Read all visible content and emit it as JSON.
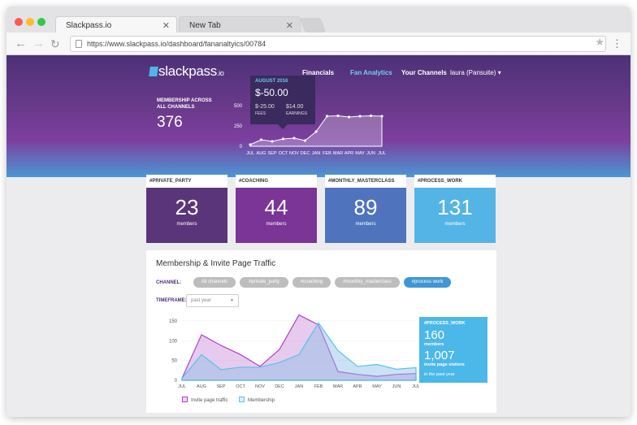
{
  "browser": {
    "tab_active": "Slackpass.io",
    "tab_inactive": "New Tab",
    "url": "https://www.slackpass.io/dashboard/fananaltyics/00784"
  },
  "app": {
    "logo": "slackpass",
    "logo_suffix": ".io",
    "nav": [
      "Financials",
      "Fan Analytics",
      "Your Channels"
    ],
    "user": "laura (Pansuite) ▾"
  },
  "hero": {
    "stat_label": "MEMBERSHIP ACROSS ALL CHANNELS",
    "stat_value": "376",
    "tooltip": {
      "month": "AUGUST 2016",
      "value": "$-50.00",
      "fees": "$-25.00",
      "fees_label": "FEES",
      "earnings": "$14.00",
      "earnings_label": "EARNINGS"
    },
    "chart_data": {
      "type": "area",
      "categories": [
        "JUL",
        "AUG",
        "SEP",
        "OCT",
        "NOV",
        "DEC",
        "JAN",
        "FEB",
        "MAR",
        "APR",
        "MAY",
        "JUN",
        "JUL"
      ],
      "values": [
        20,
        80,
        60,
        90,
        100,
        70,
        180,
        370,
        375,
        360,
        370,
        375,
        370
      ],
      "yticks": [
        "500",
        "250",
        "0"
      ],
      "ylim": [
        0,
        500
      ]
    }
  },
  "channels": [
    {
      "tag": "#PRIVATE_PARTY",
      "count": "23",
      "label": "members",
      "color": "#5b3579"
    },
    {
      "tag": "#COACHING",
      "count": "44",
      "label": "members",
      "color": "#7a3596"
    },
    {
      "tag": "#MONTHLY_MASTERCLASS",
      "count": "89",
      "label": "members",
      "color": "#4f74bd"
    },
    {
      "tag": "#PROCESS_WORK",
      "count": "131",
      "label": "members",
      "color": "#55b4e6"
    }
  ],
  "traffic": {
    "title": "Membership & Invite Page Traffic",
    "channel_label": "CHANNEL:",
    "timeframe_label": "TIMEFRAME:",
    "chips": [
      "All channels",
      "#private_party",
      "#coaching",
      "#monthly_masterclass",
      "#process work"
    ],
    "timeframe_value": "past year",
    "side": {
      "tag": "#PROCESS_WORK",
      "members": "160",
      "members_label": "members",
      "visitors": "1,007",
      "visitors_label": "invite page visitors",
      "period": "in the past year"
    },
    "legend": [
      "Invite page traffic",
      "Membership"
    ],
    "chart_data": {
      "type": "area",
      "categories": [
        "JUL",
        "AUG",
        "SEP",
        "OCT",
        "NOV",
        "DEC",
        "JAN",
        "FEB",
        "MAR",
        "APR",
        "MAY",
        "JUN",
        "JUL"
      ],
      "series": [
        {
          "name": "Invite page traffic",
          "values": [
            5,
            115,
            88,
            65,
            35,
            78,
            165,
            140,
            22,
            15,
            10,
            15,
            17
          ]
        },
        {
          "name": "Membership",
          "values": [
            5,
            65,
            27,
            33,
            33,
            45,
            65,
            145,
            75,
            35,
            40,
            28,
            32
          ]
        }
      ],
      "yticks": [
        "150",
        "100",
        "50",
        "0"
      ],
      "ylim": [
        0,
        160
      ]
    }
  }
}
